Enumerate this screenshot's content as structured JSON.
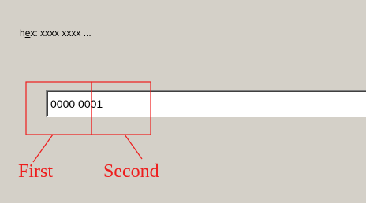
{
  "field": {
    "label_first": "h",
    "label_mnemonic": "e",
    "label_rest": "x: xxxx xxxx ...",
    "value": "0000 0001"
  },
  "annotations": {
    "first_label": "First",
    "second_label": "Second",
    "color": "#ee1c1c"
  },
  "colors": {
    "dialog_background": "#d4d0c8",
    "input_background": "#ffffff"
  }
}
